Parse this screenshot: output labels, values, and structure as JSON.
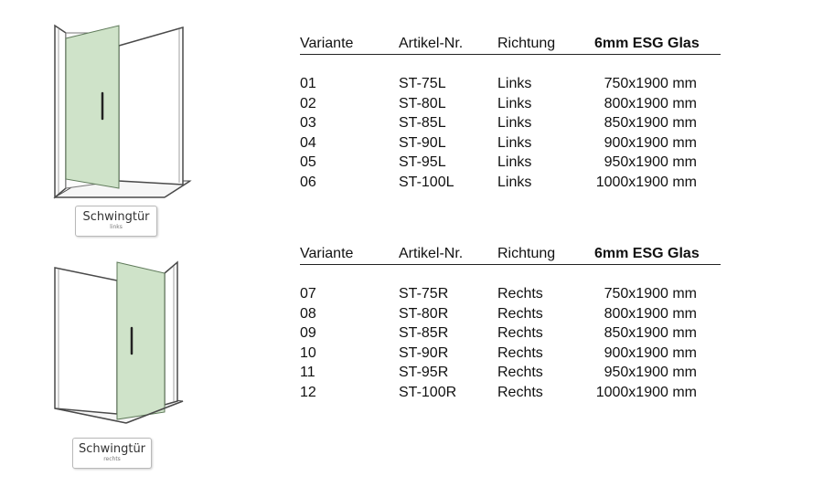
{
  "illustrations": [
    {
      "caption": "Schwingtür",
      "sub": "links"
    },
    {
      "caption": "Schwingtür",
      "sub": "rechts"
    }
  ],
  "headers": [
    "Variante",
    "Artikel-Nr.",
    "Richtung",
    "6mm ESG Glas"
  ],
  "tables": [
    {
      "rows": [
        [
          "01",
          "ST-75L",
          "Links",
          "750x1900 mm"
        ],
        [
          "02",
          "ST-80L",
          "Links",
          "800x1900 mm"
        ],
        [
          "03",
          "ST-85L",
          "Links",
          "850x1900 mm"
        ],
        [
          "04",
          "ST-90L",
          "Links",
          "900x1900 mm"
        ],
        [
          "05",
          "ST-95L",
          "Links",
          "950x1900 mm"
        ],
        [
          "06",
          "ST-100L",
          "Links",
          "1000x1900 mm"
        ]
      ]
    },
    {
      "rows": [
        [
          "07",
          "ST-75R",
          "Rechts",
          "750x1900 mm"
        ],
        [
          "08",
          "ST-80R",
          "Rechts",
          "800x1900 mm"
        ],
        [
          "09",
          "ST-85R",
          "Rechts",
          "850x1900 mm"
        ],
        [
          "10",
          "ST-90R",
          "Rechts",
          "900x1900 mm"
        ],
        [
          "11",
          "ST-95R",
          "Rechts",
          "950x1900 mm"
        ],
        [
          "12",
          "ST-100R",
          "Rechts",
          "1000x1900 mm"
        ]
      ]
    }
  ],
  "colors": {
    "glass": "#cfe3c9",
    "frame": "#3a3a3a",
    "wall": "#ffffff",
    "caption_border": "#b9b9b9"
  }
}
